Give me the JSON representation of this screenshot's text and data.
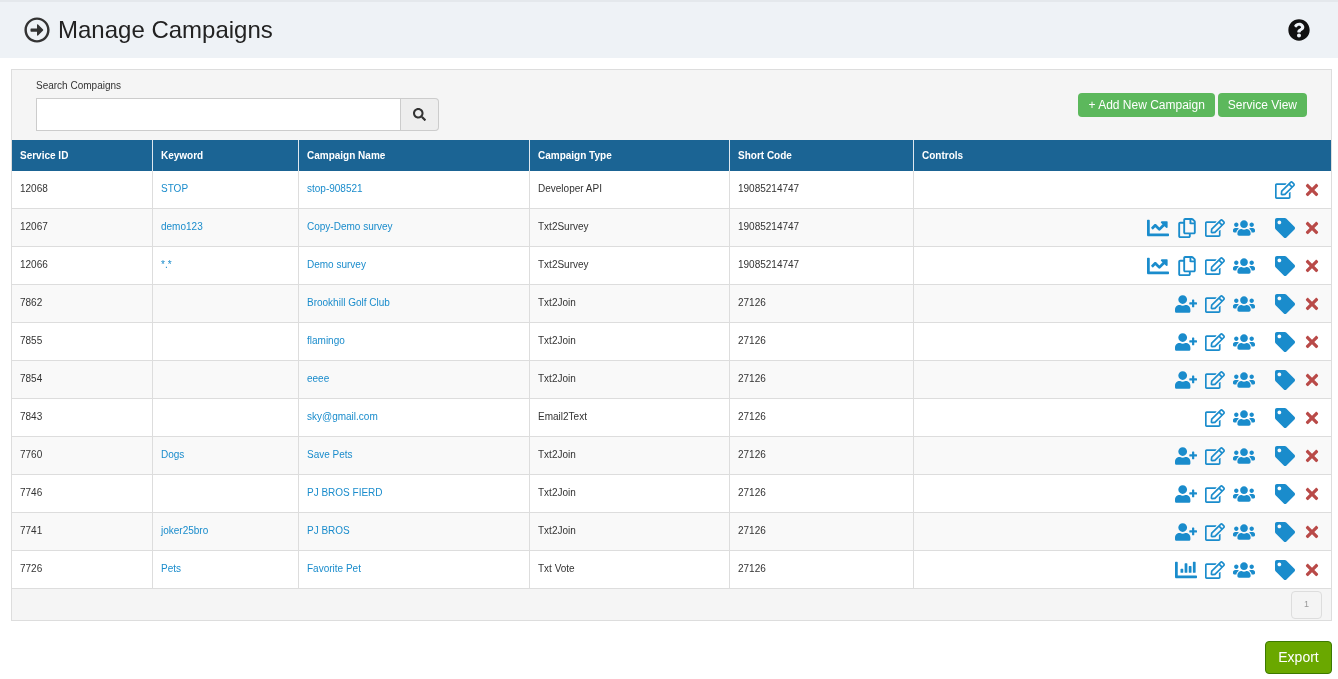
{
  "page": {
    "title": "Manage Campaigns"
  },
  "search": {
    "label": "Search Compaigns"
  },
  "actions": [
    "+ Add New Campaign",
    "Service View"
  ],
  "table": {
    "columns": [
      "Service ID",
      "Keyword",
      "Campaign Name",
      "Campaign Type",
      "Short Code",
      "Controls"
    ],
    "rows": [
      {
        "id": "12068",
        "keyword": "STOP",
        "name": "stop-908521",
        "type": "Developer API",
        "code": "19085214747",
        "controls": [
          {
            "kind": "edit"
          },
          {
            "kind": "delete"
          }
        ]
      },
      {
        "id": "12067",
        "keyword": "demo123",
        "name": "Copy-Demo survey",
        "type": "Txt2Survey",
        "code": "19085214747",
        "controls": [
          {
            "kind": "trend"
          },
          {
            "kind": "copy"
          },
          {
            "kind": "edit"
          },
          {
            "kind": "group"
          },
          {
            "kind": "tag"
          },
          {
            "kind": "delete"
          }
        ]
      },
      {
        "id": "12066",
        "keyword": "*.*",
        "name": "Demo survey",
        "type": "Txt2Survey",
        "code": "19085214747",
        "controls": [
          {
            "kind": "trend"
          },
          {
            "kind": "copy"
          },
          {
            "kind": "edit"
          },
          {
            "kind": "group"
          },
          {
            "kind": "tag"
          },
          {
            "kind": "delete"
          }
        ]
      },
      {
        "id": "7862",
        "name": "Brookhill Golf Club",
        "type": "Txt2Join",
        "code": "27126",
        "controls": [
          {
            "kind": "adduser"
          },
          {
            "kind": "edit"
          },
          {
            "kind": "group"
          },
          {
            "kind": "tag"
          },
          {
            "kind": "delete"
          }
        ]
      },
      {
        "id": "7855",
        "name": "flamingo",
        "type": "Txt2Join",
        "code": "27126",
        "controls": [
          {
            "kind": "adduser"
          },
          {
            "kind": "edit"
          },
          {
            "kind": "group"
          },
          {
            "kind": "tag"
          },
          {
            "kind": "delete"
          }
        ]
      },
      {
        "id": "7854",
        "name": "eeee",
        "type": "Txt2Join",
        "code": "27126",
        "controls": [
          {
            "kind": "adduser"
          },
          {
            "kind": "edit"
          },
          {
            "kind": "group"
          },
          {
            "kind": "tag"
          },
          {
            "kind": "delete"
          }
        ]
      },
      {
        "id": "7843",
        "name": "sky@gmail.com",
        "type": "Email2Text",
        "code": "27126",
        "controls": [
          {
            "kind": "edit"
          },
          {
            "kind": "group"
          },
          {
            "kind": "tag"
          },
          {
            "kind": "delete"
          }
        ]
      },
      {
        "id": "7760",
        "keyword": "Dogs",
        "name": "Save Pets",
        "type": "Txt2Join",
        "code": "27126",
        "controls": [
          {
            "kind": "adduser"
          },
          {
            "kind": "edit"
          },
          {
            "kind": "group"
          },
          {
            "kind": "tag"
          },
          {
            "kind": "delete"
          }
        ]
      },
      {
        "id": "7746",
        "name": "PJ BROS FIERD",
        "type": "Txt2Join",
        "code": "27126",
        "controls": [
          {
            "kind": "adduser"
          },
          {
            "kind": "edit"
          },
          {
            "kind": "group"
          },
          {
            "kind": "tag"
          },
          {
            "kind": "delete"
          }
        ]
      },
      {
        "id": "7741",
        "keyword": "joker25bro",
        "name": "PJ BROS",
        "type": "Txt2Join",
        "code": "27126",
        "controls": [
          {
            "kind": "adduser"
          },
          {
            "kind": "edit"
          },
          {
            "kind": "group"
          },
          {
            "kind": "tag"
          },
          {
            "kind": "delete"
          }
        ]
      },
      {
        "id": "7726",
        "keyword": "Pets",
        "name": "Favorite Pet",
        "type": "Txt Vote",
        "code": "27126",
        "controls": [
          {
            "kind": "bars"
          },
          {
            "kind": "edit"
          },
          {
            "kind": "group"
          },
          {
            "kind": "tag"
          },
          {
            "kind": "delete"
          }
        ]
      }
    ]
  },
  "pagination": [
    {
      "label": "1",
      "selected": true
    }
  ],
  "export": "Export"
}
